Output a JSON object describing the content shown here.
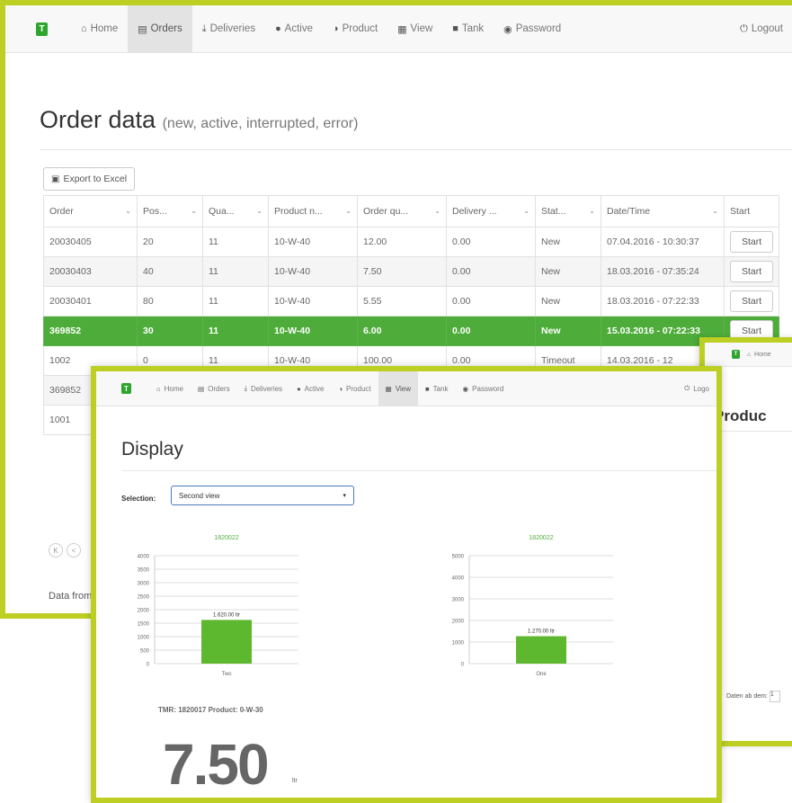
{
  "brand": {
    "accent": "#bccf22",
    "green": "#4eac3a",
    "logo_letter": "T"
  },
  "orders_window": {
    "nav": {
      "items": [
        {
          "label": "Home",
          "icon": "home-icon"
        },
        {
          "label": "Orders",
          "icon": "document-icon",
          "active": true
        },
        {
          "label": "Deliveries",
          "icon": "download-icon"
        },
        {
          "label": "Active",
          "icon": "drop-icon"
        },
        {
          "label": "Product",
          "icon": "half-circle-icon"
        },
        {
          "label": "View",
          "icon": "grid-icon"
        },
        {
          "label": "Tank",
          "icon": "tank-icon"
        },
        {
          "label": "Password",
          "icon": "eye-icon"
        }
      ],
      "logout": "Logout"
    },
    "title": "Order data",
    "subtitle": "(new, active, interrupted, error)",
    "export_label": "Export to Excel",
    "columns": [
      "Order",
      "Pos...",
      "Qua...",
      "Product n...",
      "Order qu...",
      "Delivery ...",
      "Stat...",
      "Date/Time",
      "Start"
    ],
    "rows": [
      [
        "20030405",
        "20",
        "11",
        "10-W-40",
        "12.00",
        "0.00",
        "New",
        "07.04.2016 - 10:30:37",
        "Start"
      ],
      [
        "20030403",
        "40",
        "11",
        "10-W-40",
        "7.50",
        "0.00",
        "New",
        "18.03.2016 - 07:35:24",
        "Start"
      ],
      [
        "20030401",
        "80",
        "11",
        "10-W-40",
        "5.55",
        "0.00",
        "New",
        "18.03.2016 - 07:22:33",
        "Start"
      ],
      [
        "369852",
        "30",
        "11",
        "10-W-40",
        "6.00",
        "0.00",
        "New",
        "15.03.2016 - 07:22:33",
        "Start"
      ],
      [
        "1002",
        "0",
        "11",
        "10-W-40",
        "100.00",
        "0.00",
        "Timeout",
        "14.03.2016 - 12",
        ""
      ],
      [
        "369852",
        "",
        "",
        "",
        "",
        "",
        "",
        "",
        ""
      ],
      [
        "1001",
        "",
        "",
        "",
        "",
        "",
        "",
        "",
        ""
      ]
    ],
    "selected_row": 3,
    "pager": [
      "K",
      "<"
    ],
    "footer": "Data from"
  },
  "display_window": {
    "nav": {
      "items": [
        {
          "label": "Home",
          "icon": "home-icon"
        },
        {
          "label": "Orders",
          "icon": "document-icon"
        },
        {
          "label": "Deliveries",
          "icon": "download-icon"
        },
        {
          "label": "Active",
          "icon": "drop-icon"
        },
        {
          "label": "Product",
          "icon": "half-circle-icon"
        },
        {
          "label": "View",
          "icon": "grid-icon",
          "active": true
        },
        {
          "label": "Tank",
          "icon": "tank-icon"
        },
        {
          "label": "Password",
          "icon": "eye-icon"
        }
      ],
      "logout": "Logo"
    },
    "title": "Display",
    "selection_label": "Selection:",
    "selection_value": "Second view",
    "tmr_text": "TMR: 1820017 Product: 0-W-30",
    "big_value": "7.50",
    "big_unit": "ltr"
  },
  "product_window": {
    "nav_item": "Home",
    "title": "Produc",
    "footer_label": "Daten ab dem:",
    "footer_value": "1"
  },
  "chart_data": [
    {
      "type": "bar",
      "title": "1820022",
      "categories": [
        "Two"
      ],
      "values": [
        1620
      ],
      "data_labels": [
        "1.620.00 ltr"
      ],
      "yticks": [
        0,
        500,
        1000,
        1500,
        2000,
        2500,
        3000,
        3500,
        4000
      ],
      "ylim": [
        0,
        4000
      ],
      "grid": true,
      "color": "#5eb82f"
    },
    {
      "type": "bar",
      "title": "1820022",
      "categories": [
        "One"
      ],
      "values": [
        1270
      ],
      "data_labels": [
        "1.270.00 ltr"
      ],
      "yticks": [
        0,
        1000,
        2000,
        3000,
        4000,
        5000
      ],
      "ylim": [
        0,
        5000
      ],
      "grid": true,
      "color": "#5eb82f"
    }
  ]
}
